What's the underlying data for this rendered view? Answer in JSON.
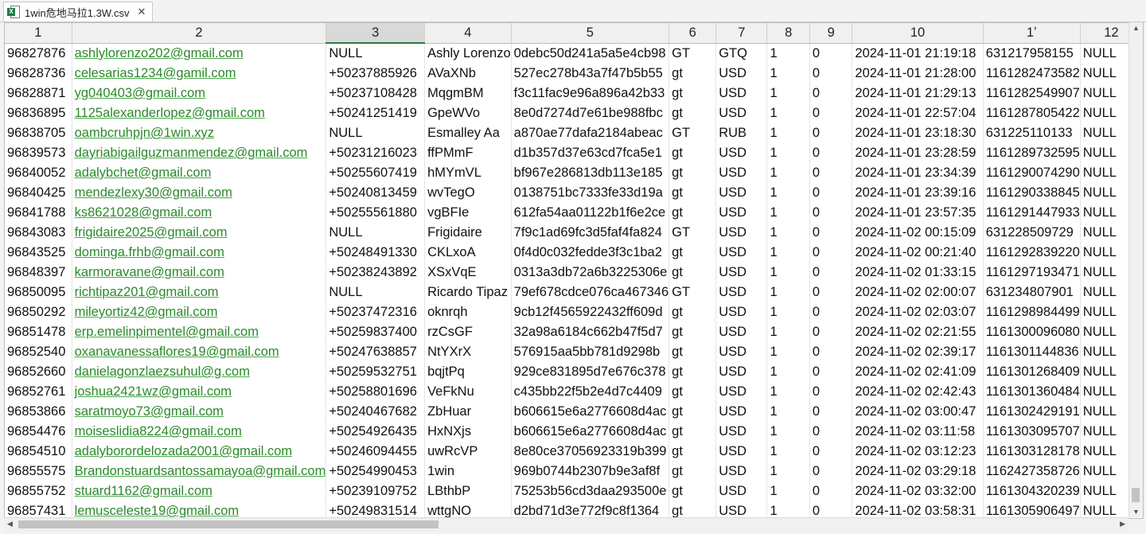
{
  "tab": {
    "title": "1win危地马拉1.3W.csv",
    "close": "✕",
    "file_icon": "excel-file-icon",
    "badge": "X"
  },
  "columns": [
    "1",
    "2",
    "3",
    "4",
    "5",
    "6",
    "7",
    "8",
    "9",
    "10",
    "1ʼ",
    "12"
  ],
  "selected_column": "3",
  "rows": [
    [
      "96827876",
      "ashlylorenzo202@gmail.com",
      "NULL",
      "Ashly Lorenzo",
      "0debc50d241a5a5e4cb98",
      "GT",
      "GTQ",
      "1",
      "0",
      "2024-11-01 21:19:18",
      "631217958155",
      "NULL"
    ],
    [
      "96828736",
      "celesarias1234@gamil.com",
      "+50237885926",
      "AVaXNb",
      "527ec278b43a7f47b5b55",
      "gt",
      "USD",
      "1",
      "0",
      "2024-11-01 21:28:00",
      "1161282473582",
      "NULL"
    ],
    [
      "96828871",
      "yg040403@gmail.com",
      "+50237108428",
      "MqgmBM",
      "f3c11fac9e96a896a42b33",
      "gt",
      "USD",
      "1",
      "0",
      "2024-11-01 21:29:13",
      "1161282549907",
      "NULL"
    ],
    [
      "96836895",
      "1125alexanderlopez@gmail.com",
      "+50241251419",
      "GpeWVo",
      "8e0d7274d7e61be988fbc",
      "gt",
      "USD",
      "1",
      "0",
      "2024-11-01 22:57:04",
      "1161287805422",
      "NULL"
    ],
    [
      "96838705",
      "oambcruhpjn@1win.xyz",
      "NULL",
      "Esmalley Aa",
      "a870ae77dafa2184abeac",
      "GT",
      "RUB",
      "1",
      "0",
      "2024-11-01 23:18:30",
      "631225110133",
      "NULL"
    ],
    [
      "96839573",
      "dayriabigailguzmanmendez@gmail.com",
      "+50231216023",
      "ffPMmF",
      "d1b357d37e63cd7fca5e1",
      "gt",
      "USD",
      "1",
      "0",
      "2024-11-01 23:28:59",
      "1161289732595",
      "NULL"
    ],
    [
      "96840052",
      "adalybchet@gmail.com",
      "+50255607419",
      "hMYmVL",
      "bf967e286813db113e185",
      "gt",
      "USD",
      "1",
      "0",
      "2024-11-01 23:34:39",
      "1161290074290",
      "NULL"
    ],
    [
      "96840425",
      "mendezlexy30@gmail.com",
      "+50240813459",
      "wvTegO",
      "0138751bc7333fe33d19a",
      "gt",
      "USD",
      "1",
      "0",
      "2024-11-01 23:39:16",
      "1161290338845",
      "NULL"
    ],
    [
      "96841788",
      "ks8621028@gmail.com",
      "+50255561880",
      "vgBFIe",
      "612fa54aa01122b1f6e2ce",
      "gt",
      "USD",
      "1",
      "0",
      "2024-11-01 23:57:35",
      "1161291447933",
      "NULL"
    ],
    [
      "96843083",
      "frigidaire2025@gmail.com",
      "NULL",
      "Frigidaire",
      "7f9c1ad69fc3d5faf4fa824",
      "GT",
      "USD",
      "1",
      "0",
      "2024-11-02 00:15:09",
      "631228509729",
      "NULL"
    ],
    [
      "96843525",
      "dominga.frhb@gmail.com",
      "+50248491330",
      "CKLxoA",
      "0f4d0c032fedde3f3c1ba2",
      "gt",
      "USD",
      "1",
      "0",
      "2024-11-02 00:21:40",
      "1161292839220",
      "NULL"
    ],
    [
      "96848397",
      "karmoravane@gmail.com",
      "+50238243892",
      "XSxVqE",
      "0313a3db72a6b3225306e",
      "gt",
      "USD",
      "1",
      "0",
      "2024-11-02 01:33:15",
      "1161297193471",
      "NULL"
    ],
    [
      "96850095",
      "richtipaz201@gmail.com",
      "NULL",
      "Ricardo Tipaz",
      "79ef678cdce076ca467346",
      "GT",
      "USD",
      "1",
      "0",
      "2024-11-02 02:00:07",
      "631234807901",
      "NULL"
    ],
    [
      "96850292",
      "mileyortiz42@gmail.com",
      "+50237472316",
      "oknrqh",
      "9cb12f4565922432ff609d",
      "gt",
      "USD",
      "1",
      "0",
      "2024-11-02 02:03:07",
      "1161298984499",
      "NULL"
    ],
    [
      "96851478",
      "erp.emelinpimentel@gmail.com",
      "+50259837400",
      "rzCsGF",
      "32a98a6184c662b47f5d7",
      "gt",
      "USD",
      "1",
      "0",
      "2024-11-02 02:21:55",
      "1161300096080",
      "NULL"
    ],
    [
      "96852540",
      "oxanavanessaflores19@gmail.com",
      "+50247638857",
      "NtYXrX",
      "576915aa5bb781d9298b",
      "gt",
      "USD",
      "1",
      "0",
      "2024-11-02 02:39:17",
      "1161301144836",
      "NULL"
    ],
    [
      "96852660",
      "danielagonzlaezsuhul@g.com",
      "+50259532751",
      "bqjtPq",
      "929ce831895d7e676c378",
      "gt",
      "USD",
      "1",
      "0",
      "2024-11-02 02:41:09",
      "1161301268409",
      "NULL"
    ],
    [
      "96852761",
      "joshua2421wz@gmail.com",
      "+50258801696",
      "VeFkNu",
      "c435bb22f5b2e4d7c4409",
      "gt",
      "USD",
      "1",
      "0",
      "2024-11-02 02:42:43",
      "1161301360484",
      "NULL"
    ],
    [
      "96853866",
      "saratmoyo73@gmail.com",
      "+50240467682",
      "ZbHuar",
      "b606615e6a2776608d4ac",
      "gt",
      "USD",
      "1",
      "0",
      "2024-11-02 03:00:47",
      "1161302429191",
      "NULL"
    ],
    [
      "96854476",
      "moiseslidia8224@gmail.com",
      "+50254926435",
      "HxNXjs",
      "b606615e6a2776608d4ac",
      "gt",
      "USD",
      "1",
      "0",
      "2024-11-02 03:11:58",
      "1161303095707",
      "NULL"
    ],
    [
      "96854510",
      "adalyborordelozada2001@gmail.com",
      "+50246094455",
      "uwRcVP",
      "8e80ce37056923319b399",
      "gt",
      "USD",
      "1",
      "0",
      "2024-11-02 03:12:23",
      "1161303128178",
      "NULL"
    ],
    [
      "96855575",
      "Brandonstuardsantossamayoa@gmail.com",
      "+50254990453",
      "1win",
      "969b0744b2307b9e3af8f",
      "gt",
      "USD",
      "1",
      "0",
      "2024-11-02 03:29:18",
      "1162427358726",
      "NULL"
    ],
    [
      "96855752",
      "stuard1162@gmail.com",
      "+50239109752",
      "LBthbP",
      "75253b56cd3daa293500e",
      "gt",
      "USD",
      "1",
      "0",
      "2024-11-02 03:32:00",
      "1161304320239",
      "NULL"
    ],
    [
      "96857431",
      "lemusceleste19@gmail.com",
      "+50249831514",
      "wttgNO",
      "d2bd71d3e772f9c8f1364",
      "gt",
      "USD",
      "1",
      "0",
      "2024-11-02 03:58:31",
      "1161305906497",
      "NULL"
    ]
  ],
  "scroll": {
    "up": "▲",
    "down": "▼",
    "left": "◀",
    "right": "▶"
  }
}
